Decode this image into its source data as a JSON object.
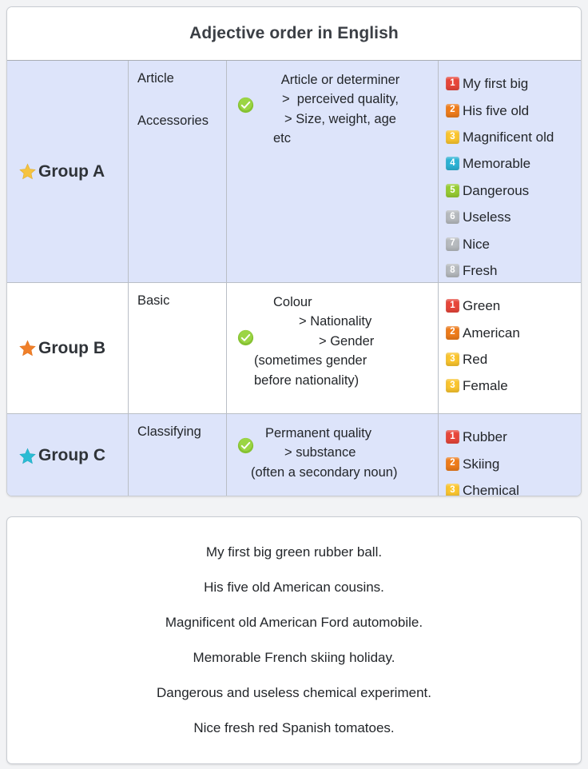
{
  "table": {
    "title": "Adjective order in English",
    "rows": [
      {
        "group_label": "Group A",
        "star_color": "#f5c33f",
        "kinds": [
          "Article",
          "Accessories"
        ],
        "rule_lines": [
          "Article or determiner",
          ">  perceived quality,",
          "> Size, weight, age",
          "etc"
        ],
        "items": [
          {
            "num": "1",
            "text": "My first big",
            "color": "#e8463a"
          },
          {
            "num": "2",
            "text": "His five old",
            "color": "#ef7c1b"
          },
          {
            "num": "3",
            "text": "Magnificent old",
            "color": "#fbc62e"
          },
          {
            "num": "4",
            "text": "Memorable",
            "color": "#2cb3d6"
          },
          {
            "num": "5",
            "text": "Dangerous",
            "color": "#97cd33"
          },
          {
            "num": "6",
            "text": "Useless",
            "color": "#b7bbbf"
          },
          {
            "num": "7",
            "text": "Nice",
            "color": "#b7bbbf"
          },
          {
            "num": "8",
            "text": "Fresh",
            "color": "#b7bbbf"
          }
        ]
      },
      {
        "group_label": "Group B",
        "star_color": "#f0802a",
        "kinds": [
          "Basic"
        ],
        "rule_lines": [
          "Colour",
          "> Nationality",
          "> Gender",
          "(sometimes gender",
          "before nationality)"
        ],
        "items": [
          {
            "num": "1",
            "text": "Green",
            "color": "#e8463a"
          },
          {
            "num": "2",
            "text": "American",
            "color": "#ef7c1b"
          },
          {
            "num": "3",
            "text": "Red",
            "color": "#fbc62e"
          },
          {
            "num": "3",
            "text": "Female",
            "color": "#fbc62e"
          }
        ]
      },
      {
        "group_label": "Group C",
        "star_color": "#2bbcd4",
        "kinds": [
          "Classifying"
        ],
        "rule_lines": [
          "Permanent quality",
          "> substance",
          "(often a secondary noun)"
        ],
        "items": [
          {
            "num": "1",
            "text": "Rubber",
            "color": "#e8463a"
          },
          {
            "num": "2",
            "text": "Skiing",
            "color": "#ef7c1b"
          },
          {
            "num": "3",
            "text": "Chemical",
            "color": "#fbc62e"
          }
        ]
      }
    ]
  },
  "examples": {
    "lines": [
      "My first big green rubber ball.",
      "His five old American cousins.",
      "Magnificent old American Ford automobile.",
      "Memorable French skiing holiday.",
      "Dangerous and useless chemical experiment.",
      "Nice fresh red Spanish tomatoes."
    ]
  }
}
